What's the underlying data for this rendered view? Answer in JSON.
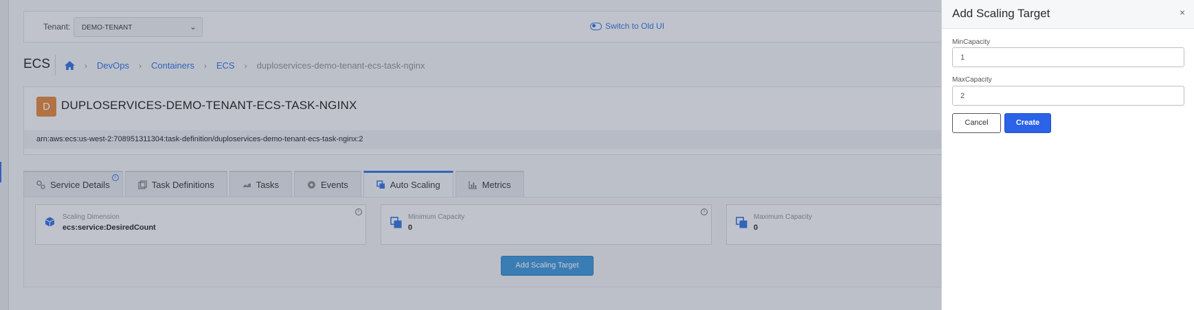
{
  "tenant": {
    "label": "Tenant:",
    "value": "DEMO-TENANT"
  },
  "switch_old_ui": "Switch to Old UI",
  "page": {
    "title": "ECS"
  },
  "breadcrumb": {
    "items": [
      "DevOps",
      "Containers",
      "ECS"
    ],
    "current": "duploservices-demo-tenant-ecs-task-nginx"
  },
  "service": {
    "avatar_letter": "D",
    "name": "DUPLOSERVICES-DEMO-TENANT-ECS-TASK-NGINX",
    "arn": "arn:aws:ecs:us-west-2:708951311304:task-definition/duploservices-demo-tenant-ecs-task-nginx:2"
  },
  "tabs": [
    {
      "label": "Service Details",
      "icon": "gears-icon"
    },
    {
      "label": "Task Definitions",
      "icon": "task-definitions-icon"
    },
    {
      "label": "Tasks",
      "icon": "tasks-icon"
    },
    {
      "label": "Events",
      "icon": "events-icon"
    },
    {
      "label": "Auto Scaling",
      "icon": "copy-icon"
    },
    {
      "label": "Metrics",
      "icon": "bar-chart-icon"
    }
  ],
  "active_tab": "Auto Scaling",
  "stats": [
    {
      "label": "Scaling Dimension",
      "value": "ecs:service:DesiredCount",
      "icon": "cube-icon"
    },
    {
      "label": "Minimum Capacity",
      "value": "0",
      "icon": "copy-icon"
    },
    {
      "label": "Maximum Capacity",
      "value": "0",
      "icon": "copy-icon"
    }
  ],
  "add_target_button": "Add Scaling Target",
  "drawer": {
    "title": "Add Scaling Target",
    "close": "×",
    "min_label": "MinCapacity",
    "min_value": "1",
    "max_label": "MaxCapacity",
    "max_value": "2",
    "cancel": "Cancel",
    "create": "Create"
  },
  "colors": {
    "accent": "#2f6fe0",
    "primary_button": "#2a62e8",
    "avatar": "#e0843c"
  }
}
